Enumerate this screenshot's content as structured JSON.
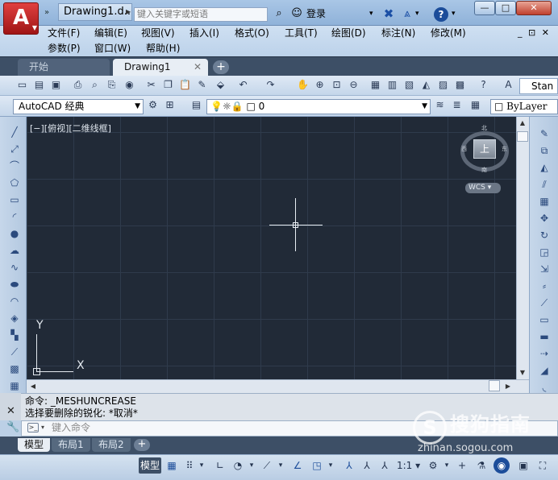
{
  "window": {
    "doc_title": "Drawing1.d...",
    "search_placeholder": "键入关键字或短语",
    "login_label": "登录",
    "help_label": "?",
    "min_glyph": "—",
    "max_glyph": "□",
    "close_glyph": "✕",
    "doc_controls": "_ ⊡ ✕"
  },
  "app_logo": "A",
  "menus": {
    "row1": [
      "文件(F)",
      "编辑(E)",
      "视图(V)",
      "插入(I)",
      "格式(O)",
      "工具(T)",
      "绘图(D)",
      "标注(N)",
      "修改(M)"
    ],
    "row2": [
      "参数(P)",
      "窗口(W)",
      "帮助(H)"
    ]
  },
  "file_tabs": {
    "start": "开始",
    "drawing": "Drawing1",
    "close_glyph": "✕",
    "add_glyph": "+"
  },
  "toolbar": {
    "text_style": "Stan"
  },
  "properties": {
    "workspace": "AutoCAD 经典",
    "layer_name": "0",
    "linetype": "ByLayer"
  },
  "viewport": {
    "label": "[−][俯视][二维线框]",
    "viewcube_face": "上",
    "compass": {
      "n": "北",
      "s": "南",
      "e": "东",
      "w": "西"
    },
    "wcs_label": "WCS ▾",
    "ucs_x": "X",
    "ucs_y": "Y",
    "background": "#212a37"
  },
  "command": {
    "line1": "命令:  _MESHUNCREASE",
    "line2": "选择要删除的锐化: *取消*",
    "input_placeholder": "键入命令"
  },
  "layout_tabs": {
    "model": "模型",
    "layout1": "布局1",
    "layout2": "布局2",
    "add_glyph": "+"
  },
  "statusbar": {
    "model_label": "模型",
    "scale": "1:1 ▾"
  },
  "watermark": {
    "logo": "S",
    "text": "搜狗指南",
    "url": "zhinan.sogou.com"
  },
  "colors": {
    "title_bar": "#a9c6e6",
    "app_logo": "#c62828",
    "viewport_bg": "#212a37",
    "tab_bar": "#3d4f66",
    "accent_blue": "#1c4d9a"
  }
}
